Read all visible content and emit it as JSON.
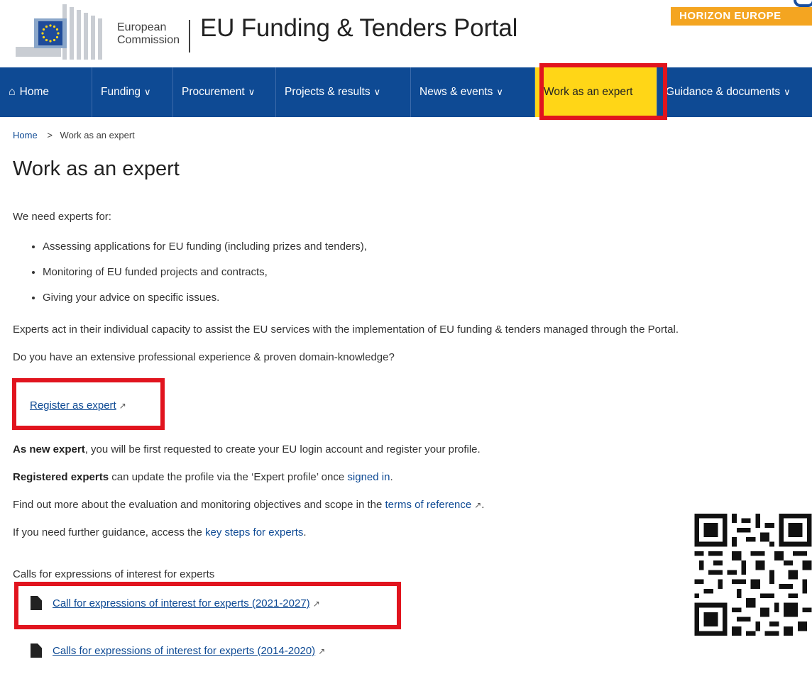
{
  "header": {
    "logo_line1": "European",
    "logo_line2": "Commission",
    "portal_title": "EU Funding & Tenders Portal",
    "badge": "HORIZON EUROPE",
    "colors": {
      "brand_blue": "#0e4a94",
      "active_yellow": "#ffd617",
      "badge_orange": "#f4a521",
      "highlight_red": "#e1141e"
    }
  },
  "nav": {
    "home": "Home",
    "funding": "Funding",
    "procurement": "Procurement",
    "projects": "Projects & results",
    "news": "News & events",
    "expert": "Work as an expert",
    "guidance": "Guidance & documents",
    "chevron": "∨"
  },
  "breadcrumb": {
    "home": "Home",
    "separator": ">",
    "current": "Work as an expert"
  },
  "page": {
    "title": "Work as an expert",
    "intro": "We need experts for:",
    "bullets": [
      "Assessing applications for EU funding (including prizes and tenders),",
      "Monitoring of EU funded projects and contracts,",
      "Giving your advice on specific issues."
    ],
    "p_capacity": "Experts act in their individual capacity to assist the EU services with the implementation of EU funding & tenders managed through the Portal.",
    "p_question": "Do you have an extensive professional experience & proven domain-knowledge?",
    "register_link": "Register as expert",
    "new_expert_bold": "As new expert",
    "new_expert_rest": ", you will be first requested to create your EU login account and register your profile.",
    "registered_bold": "Registered experts",
    "registered_rest": " can update the profile via the ‘Expert profile’ once ",
    "signed_in_link": "signed in",
    "period": ".",
    "find_out_pre": "Find out more about the evaluation and monitoring objectives and scope in the ",
    "terms_link": "terms of reference",
    "guidance_pre": "If you need further guidance, access the ",
    "key_steps_link": "key steps for experts",
    "calls_heading": "Calls for expressions of interest for experts",
    "call_2021": "Call for expressions of interest for experts (2021-2027)",
    "call_2014": "Calls for expressions of interest for experts (2014-2020)"
  }
}
